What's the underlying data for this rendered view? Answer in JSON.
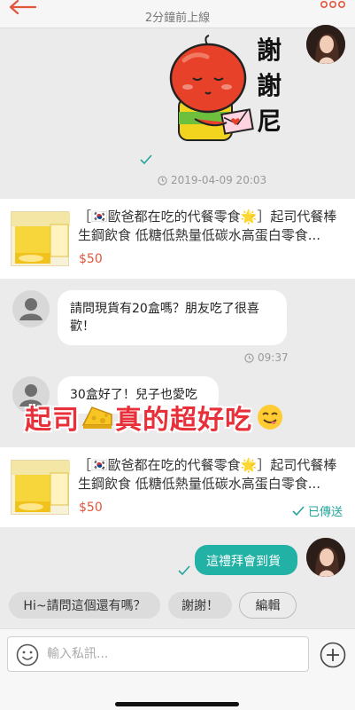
{
  "header": {
    "status": "2分鐘前上線"
  },
  "sticker": {
    "text_line1": "謝",
    "text_line2": "謝",
    "text_line3": "尼"
  },
  "messages": {
    "sticker_time": "2019-04-09 20:03",
    "product1": {
      "title": "［🇰🇷歐爸都在吃的代餐零食🌟］起司代餐棒 生鋼飲食 低糖低熱量低碳水高蛋白零食...",
      "price": "$50"
    },
    "question": "請問現貨有20盒嗎？朋友吃了很喜歡！",
    "question_time": "09:37",
    "reply": "30盒好了！兒子也愛吃",
    "overlay_text_a": "起司",
    "overlay_text_b": "真的超好吃",
    "product2": {
      "title": "［🇰🇷歐爸都在吃的代餐零食🌟］起司代餐棒 生鋼飲食 低糖低熱量低碳水高蛋白零食...",
      "price": "$50",
      "status": "已傳送"
    },
    "outgoing": "這禮拜會到貨"
  },
  "quick_replies": [
    "Hi~請問這個還有嗎？",
    "謝謝！",
    "編輯"
  ],
  "input": {
    "placeholder": "輸入私訊..."
  },
  "colors": {
    "accent": "#e1573c",
    "teal": "#22b1a5",
    "overlay_red": "#e8303a"
  }
}
